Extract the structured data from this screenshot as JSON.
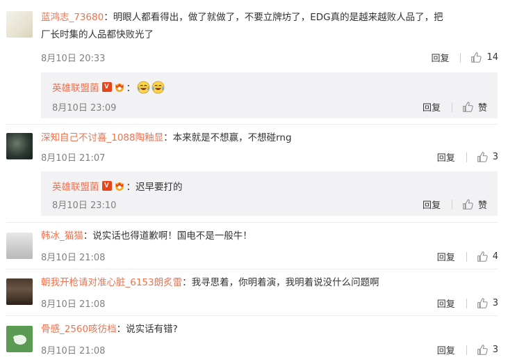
{
  "comments": [
    {
      "user": "蓝鸿志_73680",
      "text_line1": "：明眼人都看得出，做了就做了，不要立牌坊了，EDG真的是越来越败人品了，把",
      "text_line2": "厂长时集的人品都快败光了",
      "time": "8月10日 20:33",
      "reply_label": "回复",
      "likes": "14",
      "sub": {
        "user": "英雄联盟菌",
        "text": "：",
        "time": "8月10日 23:09",
        "reply_label": "回复",
        "likes": "赞"
      }
    },
    {
      "user": "深知自己不讨喜_1088陶釉显",
      "text_line1": "：本来就是不想赢，不想碰rng",
      "time": "8月10日 21:07",
      "reply_label": "回复",
      "likes": "3",
      "sub": {
        "user": "英雄联盟菌",
        "text": "：迟早要打的",
        "time": "8月10日 23:10",
        "reply_label": "回复",
        "likes": "赞"
      }
    },
    {
      "user": "韩冰_猫猫",
      "text_line1": "：说实话也得道歉啊！国电不是一般牛！",
      "time": "8月10日 21:08",
      "reply_label": "回复",
      "likes": "4"
    },
    {
      "user": "朝我开枪请对准心脏_6153朗炙雷",
      "text_line1": "：我寻思着，你明着演，我明着说没什么问题啊",
      "time": "8月10日 21:08",
      "reply_label": "回复",
      "likes": "3"
    },
    {
      "user": "骨感_2560咳彷档",
      "text_line1": "：说实话有错?",
      "time": "8月10日 21:08",
      "reply_label": "回复",
      "likes": "3"
    }
  ],
  "badges": {
    "v_label": "V"
  },
  "colors": {
    "name": "#eb7350",
    "meta": "#808080",
    "subbox_bg": "#f2f2f5"
  },
  "icons": {
    "like": "thumbs-up-icon",
    "emoji": "laugh-cry-emoji"
  }
}
